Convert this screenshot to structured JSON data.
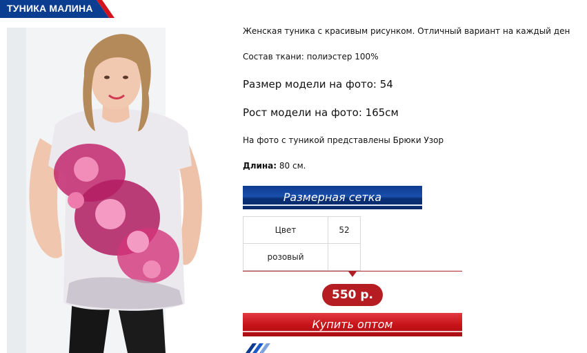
{
  "product": {
    "title": "ТУНИКА МАЛИНА",
    "description": "Женская туника с красивым рисунком. Отличный вариант на каждый ден",
    "fabric": "Состав ткани: полиэстер 100%",
    "model_size": "Размер модели на фото: 54",
    "model_height": "Рост модели на фото: 165см",
    "styled_with": "На фото с туникой представлены Брюки Узор",
    "length_label": "Длина:",
    "length_value": "80 см.",
    "size_chart_button": "Размерная сетка",
    "table": {
      "header": [
        "Цвет",
        "52"
      ],
      "rows": [
        [
          "розовый",
          ""
        ]
      ]
    },
    "price": "550 р.",
    "buy_button": "Купить оптом"
  },
  "colors": {
    "title_bg": "#0b3d91",
    "accent_red": "#c8141a",
    "button_blue": "#1a4fae"
  },
  "icons": {
    "brand_logo": "brand-stripes-logo"
  }
}
